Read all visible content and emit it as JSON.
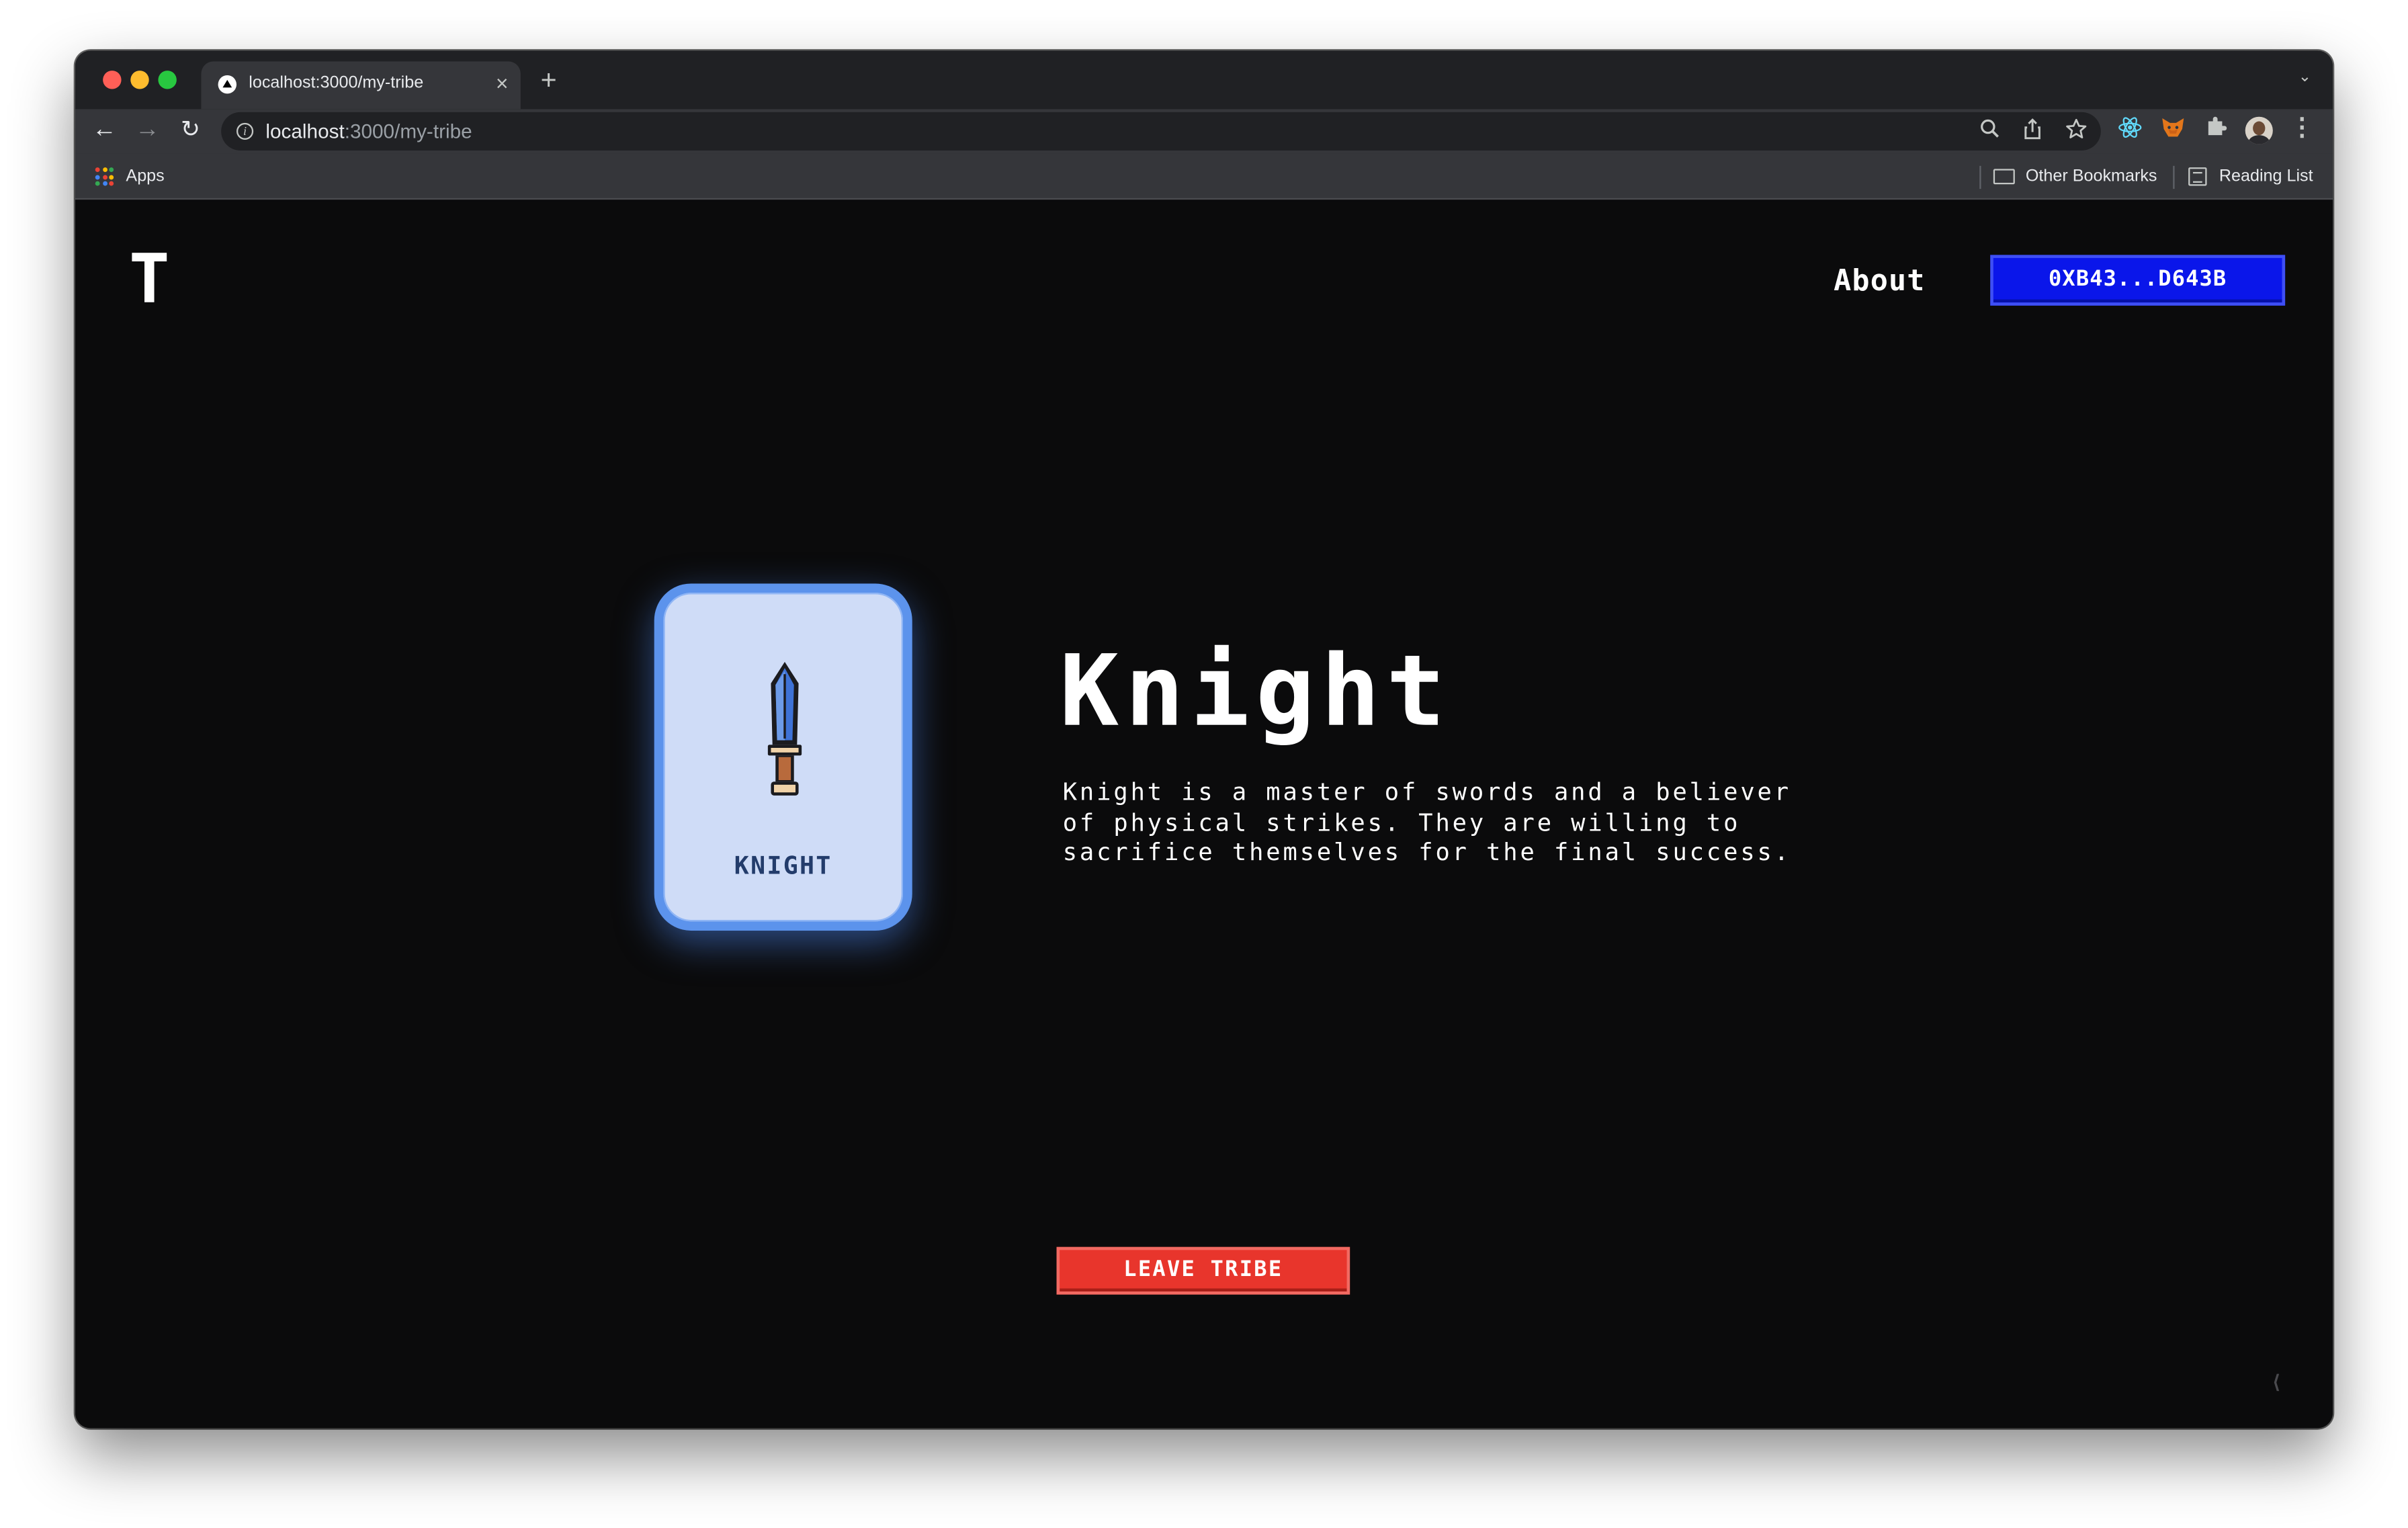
{
  "browser": {
    "tab_title": "localhost:3000/my-tribe",
    "tab_close": "×",
    "new_tab": "+",
    "tab_menu": "⌄",
    "url_host": "localhost",
    "url_rest": ":3000/my-tribe",
    "nav": {
      "back": "←",
      "forward": "→",
      "reload": "↻"
    },
    "bookmarks": {
      "apps_label": "Apps",
      "other_bookmarks_label": "Other Bookmarks",
      "reading_list_label": "Reading List"
    },
    "icons": {
      "zoom": "zoom-icon",
      "share": "share-icon",
      "star": "star-icon",
      "react_devtools": "react-icon",
      "metamask": "fox-icon",
      "extensions": "puzzle-icon",
      "menu": "kebab-menu-icon"
    }
  },
  "site": {
    "logo": "T",
    "nav_about": "About",
    "wallet_address": "0XB43...D643B"
  },
  "tribe": {
    "card_label": "KNIGHT",
    "card_icon": "sword-icon",
    "title": "Knight",
    "description": "Knight is a master of swords and a believer\nof physical strikes. They are willing to\nsacrifice themselves for the final success.",
    "leave_button": "LEAVE TRIBE"
  },
  "colors": {
    "page_bg": "#0b0b0c",
    "wallet_button": "#0a16ea",
    "leave_button": "#e8352c",
    "card_bg": "#cfdcf7",
    "card_border": "#5c93ec"
  }
}
